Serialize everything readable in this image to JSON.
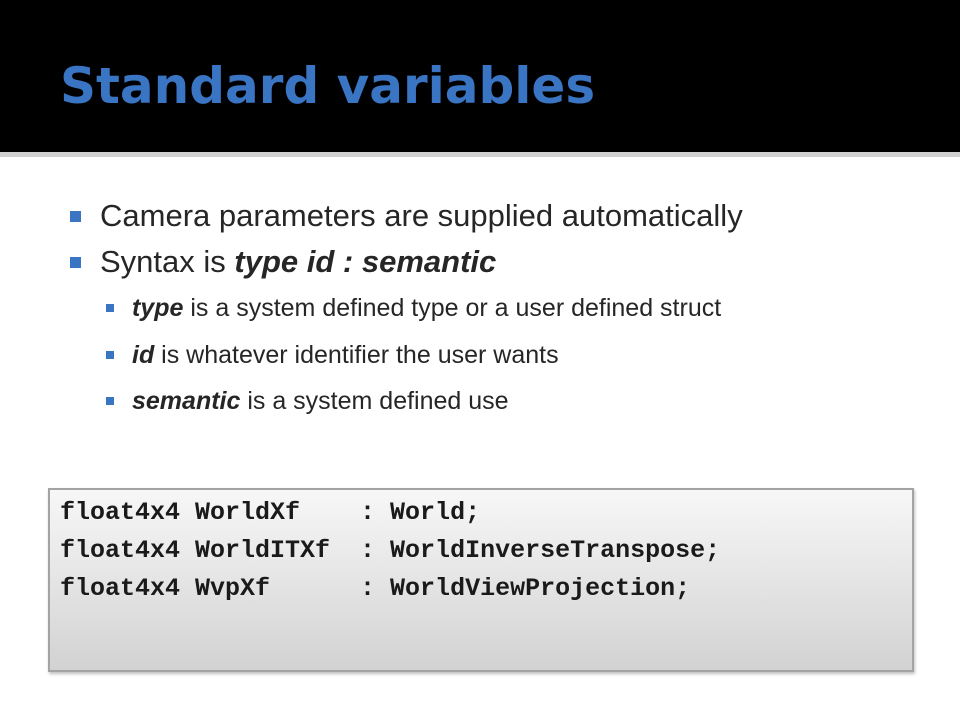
{
  "slide": {
    "title": "Standard variables",
    "bullets": [
      {
        "text": "Camera parameters are supplied automatically"
      },
      {
        "prefix": "Syntax is ",
        "term": "type id : semantic"
      }
    ],
    "sub_bullets": [
      {
        "term": "type",
        "text": " is a system defined type or a user defined struct"
      },
      {
        "term": "id",
        "text": " is whatever identifier the user wants"
      },
      {
        "term": "semantic",
        "text": " is a system defined use"
      }
    ],
    "code_lines": [
      "float4x4 WorldXf    : World;",
      "float4x4 WorldITXf  : WorldInverseTranspose;",
      "float4x4 WvpXf      : WorldViewProjection;"
    ]
  },
  "colors": {
    "title_bar_background": "#000000",
    "title_text": "#3a75c4",
    "bullet_marker": "#3a75c4",
    "body_text": "#262626",
    "code_box_border": "#a3a3a3"
  },
  "icons": {
    "level1_marker": "square-bullet-icon",
    "level2_marker": "small-square-bullet-icon"
  }
}
